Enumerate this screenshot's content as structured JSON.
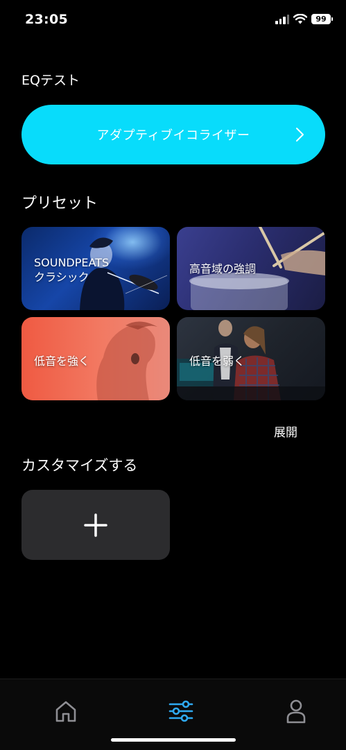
{
  "status": {
    "time": "23:05",
    "battery": "99"
  },
  "eq_test": {
    "title": "EQテスト",
    "adaptive_button_label": "アダプティブイコライザー"
  },
  "presets": {
    "title": "プリセット",
    "cards": [
      {
        "label": "SOUNDPEATS\nクラシック"
      },
      {
        "label": "高音域の強調"
      },
      {
        "label": "低音を強く"
      },
      {
        "label": "低音を弱く"
      }
    ],
    "expand_label": "展開"
  },
  "custom": {
    "title": "カスタマイズする"
  },
  "colors": {
    "accent": "#08dcfb",
    "background": "#000000",
    "tile": "#2c2c2e",
    "tab_inactive": "#8e8e93",
    "tab_active": "#2fa9f0"
  },
  "tab_bar": {
    "tabs": [
      {
        "icon": "home-icon",
        "active": false
      },
      {
        "icon": "equalizer-icon",
        "active": true
      },
      {
        "icon": "profile-icon",
        "active": false
      }
    ]
  }
}
